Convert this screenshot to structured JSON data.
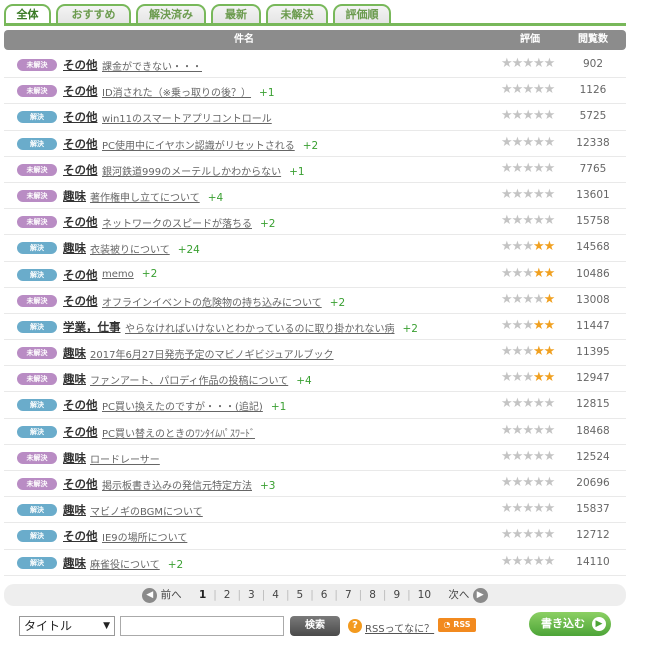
{
  "tabs": [
    {
      "label": "全体",
      "active": true
    },
    {
      "label": "おすすめ",
      "active": false
    },
    {
      "label": "解決済み",
      "active": false
    },
    {
      "label": "最新",
      "active": false
    },
    {
      "label": "未解決",
      "active": false
    },
    {
      "label": "評価順",
      "active": false
    }
  ],
  "header": {
    "subject": "件名",
    "rating": "評価",
    "views": "閲覧数"
  },
  "rows": [
    {
      "status": "未解決",
      "status_type": "open",
      "category": "その他",
      "title": "課金ができない・・・",
      "plus": "",
      "rating": 0,
      "views": "902"
    },
    {
      "status": "未解決",
      "status_type": "open",
      "category": "その他",
      "title": "ID消された（※乗っ取りの後？）",
      "plus": "+1",
      "rating": 0,
      "views": "1126"
    },
    {
      "status": "解決",
      "status_type": "done",
      "category": "その他",
      "title": "win11のスマートアプリコントロール",
      "plus": "",
      "rating": 0,
      "views": "5725"
    },
    {
      "status": "解決",
      "status_type": "done",
      "category": "その他",
      "title": "PC使用中にイヤホン認識がリセットされる",
      "plus": "+2",
      "rating": 0,
      "views": "12338"
    },
    {
      "status": "未解決",
      "status_type": "open",
      "category": "その他",
      "title": "銀河鉄道999のメーテルしかわからない",
      "plus": "+1",
      "rating": 0,
      "views": "7765"
    },
    {
      "status": "未解決",
      "status_type": "open",
      "category": "趣味",
      "title": "著作権申し立てについて",
      "plus": "+4",
      "rating": 0,
      "views": "13601"
    },
    {
      "status": "未解決",
      "status_type": "open",
      "category": "その他",
      "title": "ネットワークのスピードが落ちる",
      "plus": "+2",
      "rating": 0,
      "views": "15758"
    },
    {
      "status": "解決",
      "status_type": "done",
      "category": "趣味",
      "title": "衣装被りについて",
      "plus": "+24",
      "rating": 2,
      "views": "14568"
    },
    {
      "status": "解決",
      "status_type": "done",
      "category": "その他",
      "title": "memo",
      "plus": "+2",
      "rating": 2,
      "views": "10486"
    },
    {
      "status": "未解決",
      "status_type": "open",
      "category": "その他",
      "title": "オフラインイベントの危険物の持ち込みについて",
      "plus": "+2",
      "rating": 1,
      "views": "13008"
    },
    {
      "status": "解決",
      "status_type": "done",
      "category": "学業，仕事",
      "title": "やらなければいけないとわかっているのに取り掛かれない病",
      "plus": "+2",
      "rating": 2,
      "views": "11447"
    },
    {
      "status": "未解決",
      "status_type": "open",
      "category": "趣味",
      "title": "2017年6月27日発売予定のマビノギビジュアルブック",
      "plus": "",
      "rating": 2,
      "views": "11395"
    },
    {
      "status": "未解決",
      "status_type": "open",
      "category": "趣味",
      "title": "ファンアート、パロディ作品の投稿について",
      "plus": "+4",
      "rating": 2,
      "views": "12947"
    },
    {
      "status": "解決",
      "status_type": "done",
      "category": "その他",
      "title": "PC買い換えたのですが・・・(追記)",
      "plus": "+1",
      "rating": 0,
      "views": "12815"
    },
    {
      "status": "解決",
      "status_type": "done",
      "category": "その他",
      "title": "PC買い替えのときのﾜﾝﾀｲﾑﾊﾟｽﾜｰﾄﾞ",
      "plus": "",
      "rating": 0,
      "views": "18468"
    },
    {
      "status": "未解決",
      "status_type": "open",
      "category": "趣味",
      "title": "ロードレーサー",
      "plus": "",
      "rating": 0,
      "views": "12524"
    },
    {
      "status": "未解決",
      "status_type": "open",
      "category": "その他",
      "title": "掲示板書き込みの発信元特定方法",
      "plus": "+3",
      "rating": 0,
      "views": "20696"
    },
    {
      "status": "解決",
      "status_type": "done",
      "category": "趣味",
      "title": "マビノギのBGMについて",
      "plus": "",
      "rating": 0,
      "views": "15837"
    },
    {
      "status": "解決",
      "status_type": "done",
      "category": "その他",
      "title": "IE9の場所について",
      "plus": "",
      "rating": 0,
      "views": "12712"
    },
    {
      "status": "解決",
      "status_type": "done",
      "category": "趣味",
      "title": "麻雀役について",
      "plus": "+2",
      "rating": 0,
      "views": "14110"
    }
  ],
  "pager": {
    "prev_label": "前へ",
    "next_label": "次へ",
    "pages": [
      "1",
      "2",
      "3",
      "4",
      "5",
      "6",
      "7",
      "8",
      "9",
      "10"
    ],
    "current": "1"
  },
  "search": {
    "select_value": "タイトル",
    "input_value": "",
    "button_label": "検索",
    "rss_link": "RSSってなに？",
    "rss_button": "RSS"
  },
  "write_button": "書き込む",
  "colors": {
    "accent": "#78b85a",
    "open_badge": "#b98cc4",
    "done_badge": "#6aaccb",
    "star_on": "#f0a020",
    "star_off": "#c4c4c4"
  },
  "icons": {
    "prev": "arrow-left-circle-icon",
    "next": "arrow-right-circle-icon",
    "help": "question-icon",
    "write": "arrow-right-circle-icon"
  }
}
